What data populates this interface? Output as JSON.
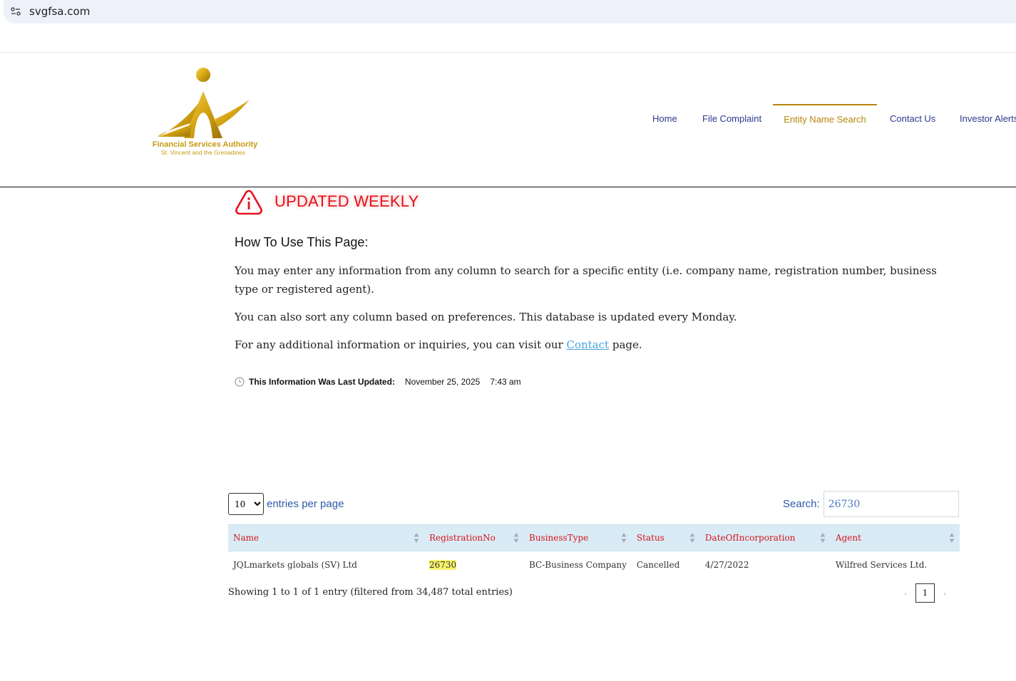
{
  "browser": {
    "url": "svgfsa.com",
    "site_icon": "site-settings-icon"
  },
  "logo": {
    "line1": "Financial Services Authority",
    "line2": "St. Vincent and the Grenadines",
    "gold": "#c79a10"
  },
  "nav": [
    {
      "label": "Home"
    },
    {
      "label": "File Complaint"
    },
    {
      "label": "Entity Name Search",
      "active": true
    },
    {
      "label": "Contact Us"
    },
    {
      "label": "Investor Alerts"
    }
  ],
  "alert": {
    "text": "UPDATED WEEKLY",
    "color": "#e5131d",
    "icon": "info-triangle-icon"
  },
  "howto": {
    "title": "How To Use This Page:",
    "p1": "You may enter any information from any column to search for a specific entity (i.e. company name, registration number, business type or registered agent).",
    "p2": "You can also sort any column based on preferences. This database is updated every Monday.",
    "p3_before": "For any additional information or inquiries, you can visit our ",
    "p3_link": "Contact",
    "p3_after": " page."
  },
  "updated": {
    "label": "This Information Was Last Updated:",
    "date": "November 25, 2025",
    "time": "7:43 am"
  },
  "table_controls": {
    "entries_value": "10",
    "entries_label": "entries per page",
    "search_label": "Search:",
    "search_value": "26730"
  },
  "table": {
    "headers": [
      "Name",
      "RegistrationNo",
      "BusinessType",
      "Status",
      "DateOfIncorporation",
      "Agent"
    ],
    "rows": [
      [
        "JQLmarkets globals (SV) Ltd",
        "26730",
        "BC-Business Company",
        "Cancelled",
        "4/27/2022",
        "Wilfred Services Ltd."
      ]
    ]
  },
  "footer": {
    "showing": "Showing 1 to 1 of 1 entry (filtered from 34,487 total entries)",
    "prev": "‹",
    "page": "1",
    "next": "›"
  }
}
